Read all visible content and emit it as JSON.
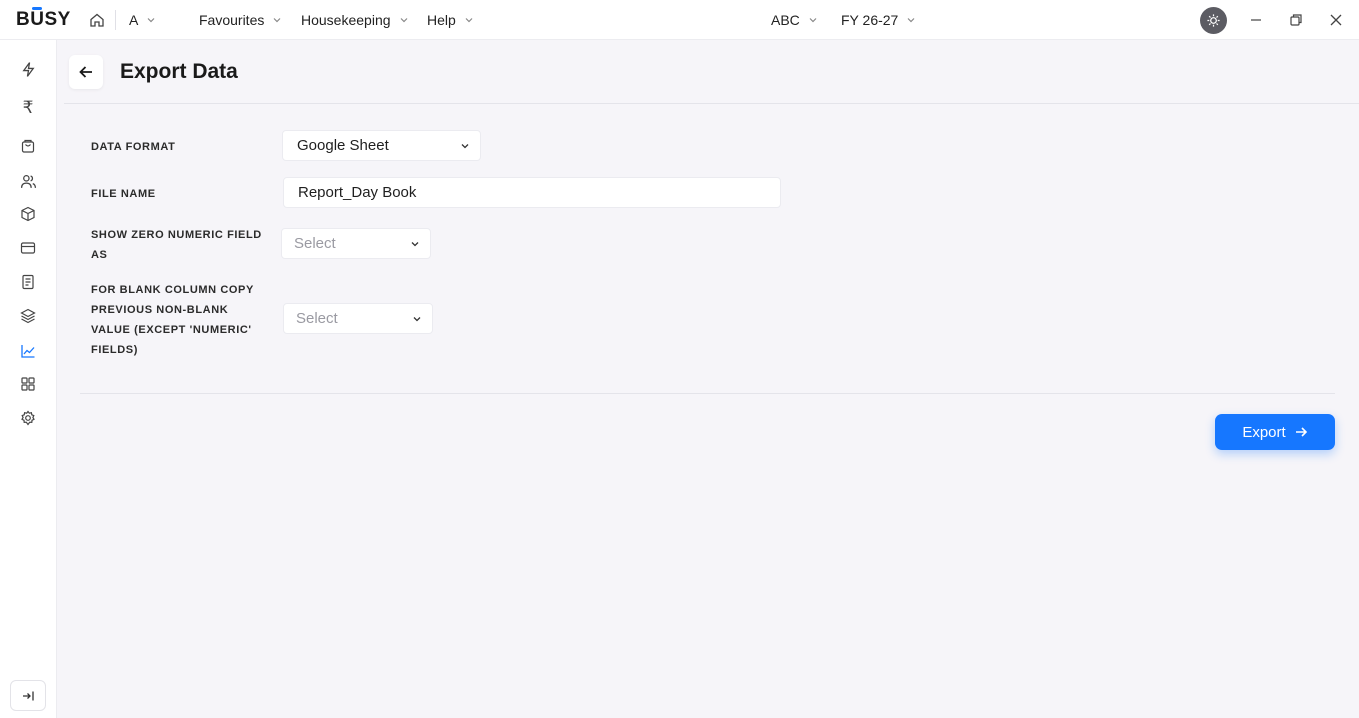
{
  "app": {
    "logo_text": "BUSY",
    "company_short": "A",
    "company": "ABC",
    "fiscal_year": "FY 26-27"
  },
  "menu": [
    {
      "label": "Favourites"
    },
    {
      "label": "Housekeeping"
    },
    {
      "label": "Help"
    }
  ],
  "sidebar_icons": [
    "flash-icon",
    "rupee-icon",
    "shopping-bag-icon",
    "users-icon",
    "box-icon",
    "card-icon",
    "document-icon",
    "layers-icon",
    "chart-icon",
    "grid-icon",
    "settings-icon"
  ],
  "page": {
    "title": "Export Data"
  },
  "form": {
    "data_format": {
      "label": "DATA FORMAT",
      "value": "Google Sheet"
    },
    "file_name": {
      "label": "FILE NAME",
      "value": "Report_Day Book"
    },
    "show_zero": {
      "label": "SHOW ZERO NUMERIC FIELD AS",
      "placeholder": "Select"
    },
    "blank_column": {
      "label": "FOR BLANK COLUMN COPY PREVIOUS NON-BLANK VALUE (EXCEPT 'NUMERIC' FIELDS)",
      "placeholder": "Select"
    }
  },
  "actions": {
    "export_label": "Export"
  },
  "colors": {
    "accent": "#1677ff",
    "background": "#f6f5f9"
  }
}
